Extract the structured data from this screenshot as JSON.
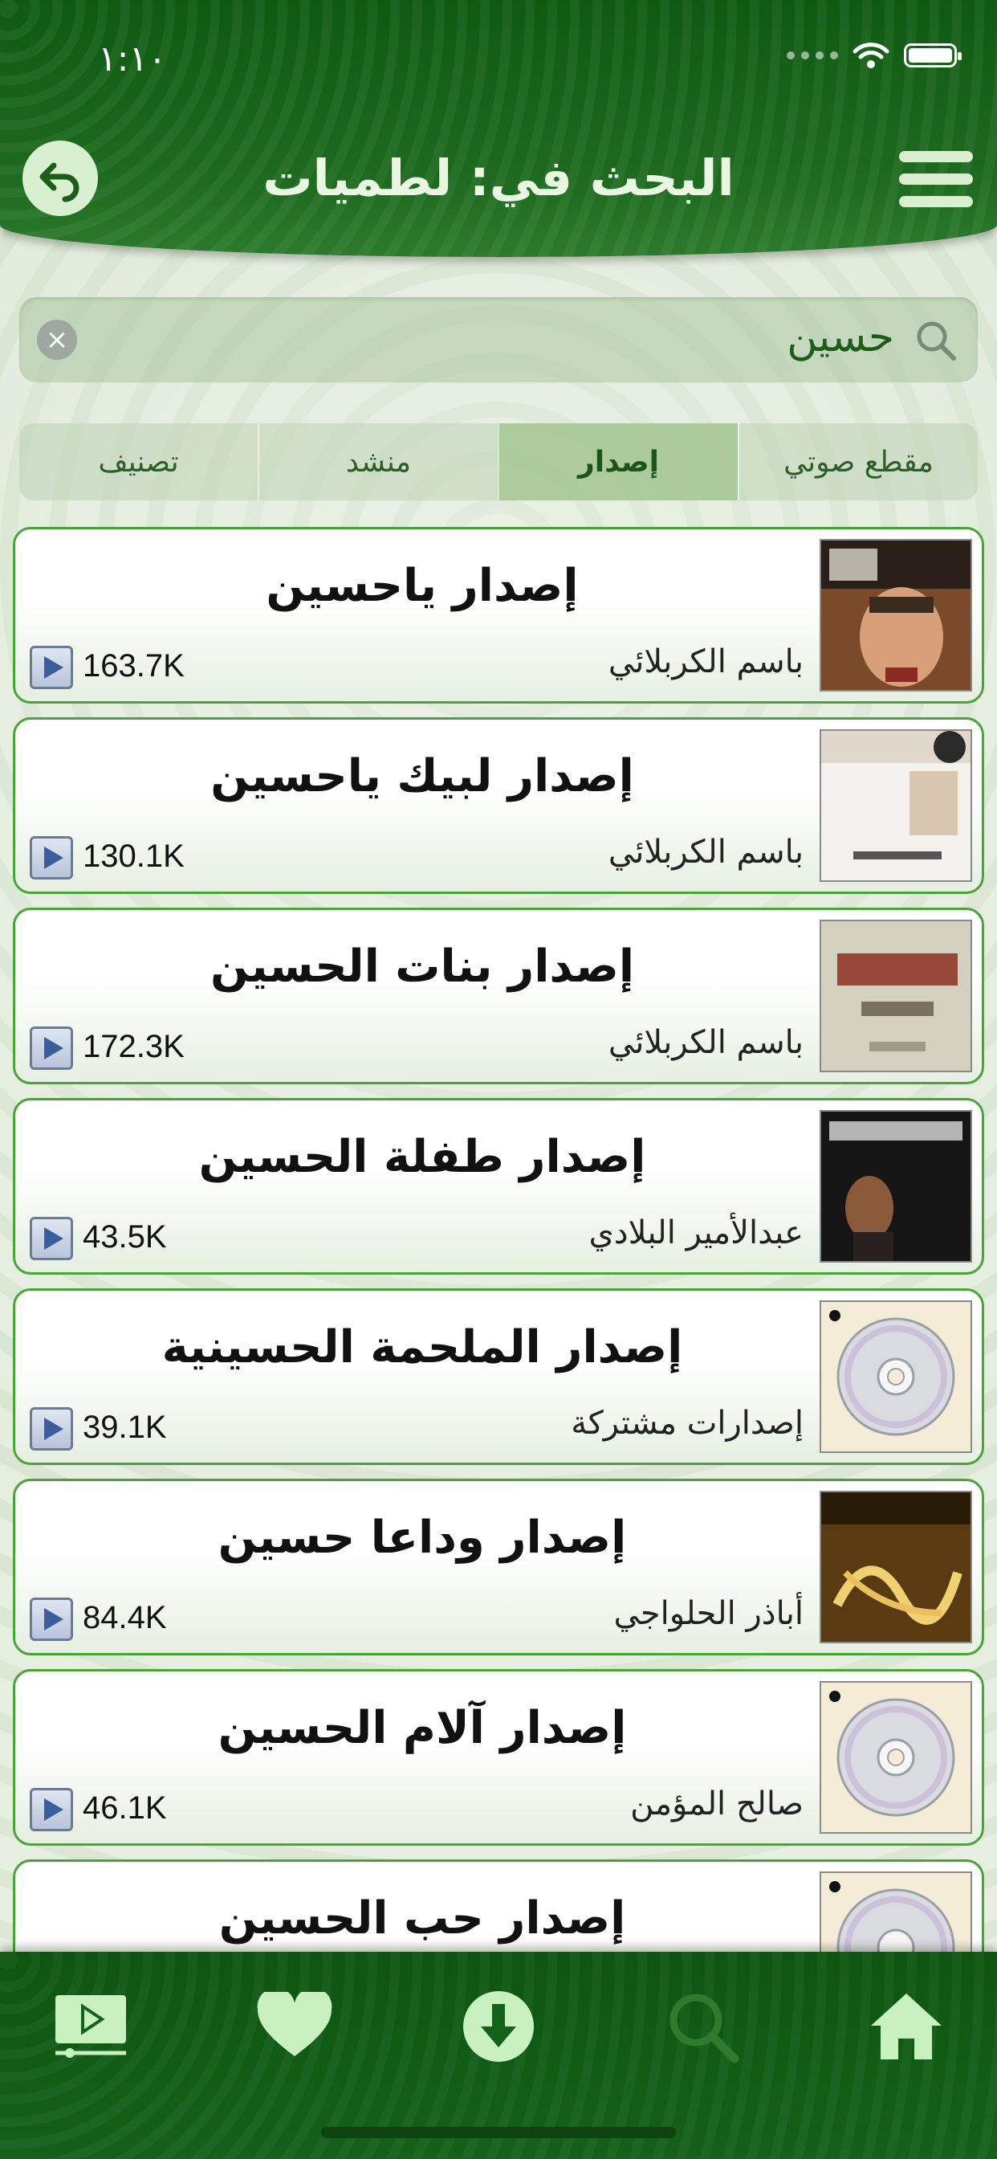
{
  "status_bar": {
    "time": "١:١٠"
  },
  "header": {
    "title": "البحث في: لطميات"
  },
  "search": {
    "query": "حسين"
  },
  "segments": [
    {
      "label": "تصنيف",
      "active": false
    },
    {
      "label": "منشد",
      "active": false
    },
    {
      "label": "إصدار",
      "active": true
    },
    {
      "label": "مقطع صوتي",
      "active": false
    }
  ],
  "results": [
    {
      "title": "إصدار ياحسين",
      "artist": "باسم الكربلائي",
      "count": "163.7K",
      "thumb": "photo-singer"
    },
    {
      "title": "إصدار لبيك ياحسين",
      "artist": "باسم الكربلائي",
      "count": "130.1K",
      "thumb": "light-cover"
    },
    {
      "title": "إصدار بنات الحسين",
      "artist": "باسم الكربلائي",
      "count": "172.3K",
      "thumb": "calligraphy-cover"
    },
    {
      "title": "إصدار طفلة الحسين",
      "artist": "عبدالأمير البلادي",
      "count": "43.5K",
      "thumb": "dark-portrait"
    },
    {
      "title": "إصدار الملحمة الحسينية",
      "artist": "إصدارات مشتركة",
      "count": "39.1K",
      "thumb": "cd-placeholder"
    },
    {
      "title": "إصدار وداعا حسين",
      "artist": "أباذر الحلواجي",
      "count": "84.4K",
      "thumb": "gold-calligraphy"
    },
    {
      "title": "إصدار آلام الحسين",
      "artist": "صالح المؤمن",
      "count": "46.1K",
      "thumb": "cd-placeholder"
    },
    {
      "title": "إصدار حب الحسين",
      "artist": "",
      "count": "",
      "thumb": "cd-placeholder"
    }
  ],
  "tabbar": {
    "items": [
      "video-icon",
      "heart-icon",
      "download-icon",
      "search-icon",
      "home-icon"
    ],
    "active": "search-icon"
  },
  "colors": {
    "header": "#1e6a1f",
    "accent": "#49a43a",
    "tab_icon": "#c9f0bf",
    "tab_icon_active": "#2e7b2e"
  }
}
